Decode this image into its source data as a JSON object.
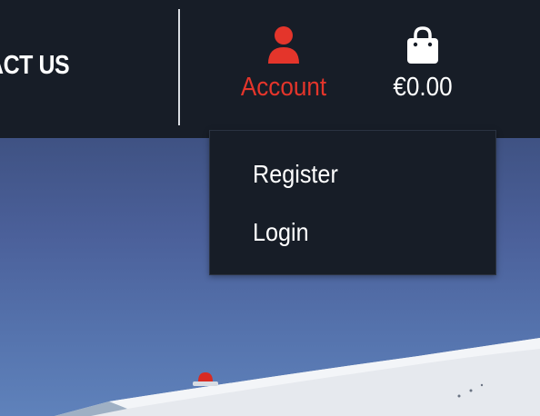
{
  "header": {
    "nav_contact_label": "ACT US",
    "account": {
      "icon": "user-icon",
      "label": "Account",
      "color": "#e4352b"
    },
    "cart": {
      "icon": "shopping-bag-icon",
      "amount": "€0.00"
    },
    "background": "#171d27"
  },
  "account_dropdown": {
    "items": [
      {
        "label": "Register"
      },
      {
        "label": "Login"
      }
    ]
  }
}
